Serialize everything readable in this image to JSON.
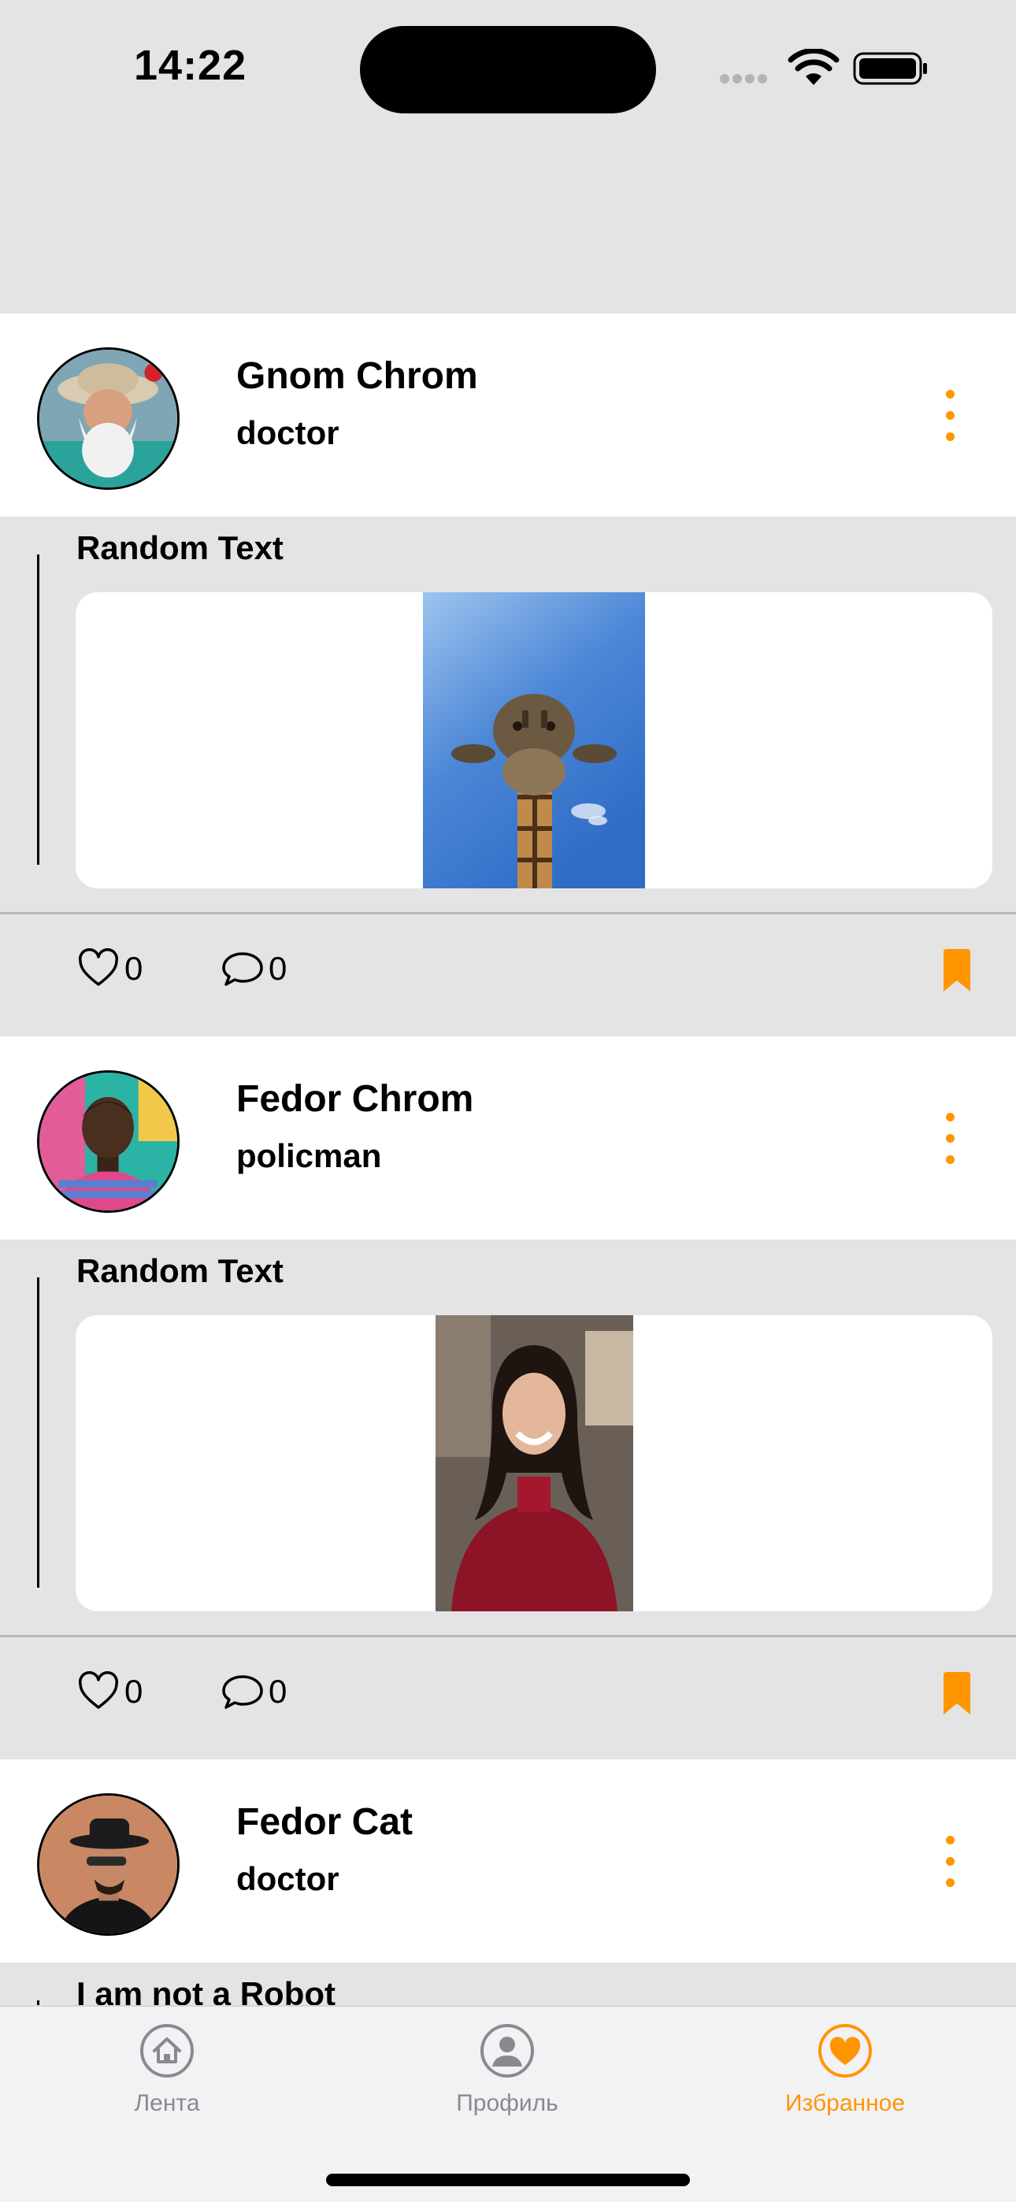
{
  "status_bar": {
    "time": "14:22"
  },
  "posts": [
    {
      "author": "Gnom Chrom",
      "job": "doctor",
      "title": "Random Text",
      "likes": "0",
      "comments": "0",
      "image": "giraffe-photo",
      "avatar": "bearded-man-avatar"
    },
    {
      "author": "Fedor Chrom",
      "job": "policman",
      "title": "Random Text",
      "likes": "0",
      "comments": "0",
      "image": "smiling-woman-photo",
      "avatar": "man-avatar"
    },
    {
      "author": "Fedor Cat",
      "job": "doctor",
      "title": "I am not a Robot",
      "avatar": "hat-man-avatar"
    }
  ],
  "tabbar": {
    "items": [
      {
        "label": "Лента",
        "icon": "home-icon",
        "active": false
      },
      {
        "label": "Профиль",
        "icon": "person-icon",
        "active": false
      },
      {
        "label": "Избранное",
        "icon": "heart-icon",
        "active": true
      }
    ]
  },
  "colors": {
    "accent": "#ff9500",
    "background": "#e4e4e4",
    "card": "#ffffff",
    "inactive": "#8a8a8e"
  }
}
